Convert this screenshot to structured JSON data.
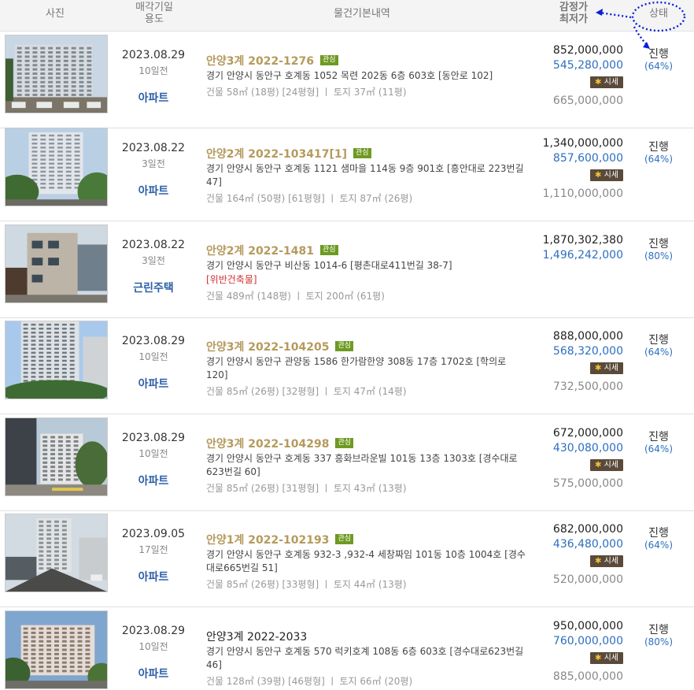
{
  "header": {
    "photo": "사진",
    "date_line1": "매각기일",
    "date_line2": "용도",
    "info": "물건기본내역",
    "price_line1": "감정가",
    "price_line2": "최저가",
    "status": "상태"
  },
  "badge_label": "관심",
  "market_label": "시세",
  "rows": [
    {
      "date": "2023.08.29",
      "ago": "10일전",
      "use": "아파트",
      "case": "안양3계 2022-1276",
      "badge": "관심",
      "addr": "경기 안양시 동안구 호계동 1052 목련 202동 6층 603호 [동안로 102]",
      "area": "건물 58㎡ (18평) [24평형]  ㅣ  토지 37㎡ (11평)",
      "appraised": "852,000,000",
      "min": "545,280,000",
      "market": "시세",
      "sale": "665,000,000",
      "status": "진행",
      "pct": "(64%)"
    },
    {
      "date": "2023.08.22",
      "ago": "3일전",
      "use": "아파트",
      "case": "안양2계 2022-103417[1]",
      "badge": "관심",
      "addr": "경기 안양시 동안구 호계동 1121 샘마을 114동 9층 901호 [흥안대로 223번길 47]",
      "area": "건물 164㎡ (50평) [61평형]  ㅣ  토지 87㎡ (26평)",
      "appraised": "1,340,000,000",
      "min": "857,600,000",
      "market": "시세",
      "sale": "1,110,000,000",
      "status": "진행",
      "pct": "(64%)"
    },
    {
      "date": "2023.08.22",
      "ago": "3일전",
      "use": "근린주택",
      "case": "안양2계 2022-1481",
      "badge": "관심",
      "addr": "경기 안양시 동안구 비산동 1014-6 [평촌대로411번길 38-7]",
      "warn": "[위반건축물]",
      "area": "건물 489㎡ (148평)  ㅣ  토지 200㎡ (61평)",
      "appraised": "1,870,302,380",
      "min": "1,496,242,000",
      "status": "진행",
      "pct": "(80%)"
    },
    {
      "date": "2023.08.29",
      "ago": "10일전",
      "use": "아파트",
      "case": "안양3계 2022-104205",
      "badge": "관심",
      "addr": "경기 안양시 동안구 관양동 1586 한가람한양 308동 17층 1702호 [학의로 120]",
      "area": "건물 85㎡ (26평) [32평형]  ㅣ  토지 47㎡ (14평)",
      "appraised": "888,000,000",
      "min": "568,320,000",
      "market": "시세",
      "sale": "732,500,000",
      "status": "진행",
      "pct": "(64%)"
    },
    {
      "date": "2023.08.29",
      "ago": "10일전",
      "use": "아파트",
      "case": "안양3계 2022-104298",
      "badge": "관심",
      "addr": "경기 안양시 동안구 호계동 337 흥화브라운빌 101동 13층 1303호 [경수대로623번길 60]",
      "area": "건물 85㎡ (26평) [31평형]  ㅣ  토지 43㎡ (13평)",
      "appraised": "672,000,000",
      "min": "430,080,000",
      "market": "시세",
      "sale": "575,000,000",
      "status": "진행",
      "pct": "(64%)"
    },
    {
      "date": "2023.09.05",
      "ago": "17일전",
      "use": "아파트",
      "case": "안양1계 2022-102193",
      "badge": "관심",
      "addr": "경기 안양시 동안구 호계동 932-3 ,932-4 세창짜임 101동 10층 1004호 [경수대로665번길 51]",
      "area": "건물 85㎡ (26평) [33평형]  ㅣ  토지 44㎡ (13평)",
      "appraised": "682,000,000",
      "min": "436,480,000",
      "market": "시세",
      "sale": "520,000,000",
      "status": "진행",
      "pct": "(64%)"
    },
    {
      "date": "2023.08.29",
      "ago": "10일전",
      "use": "아파트",
      "case": "안양3계 2022-2033",
      "case_dark": true,
      "addr": "경기 안양시 동안구 호계동 570 럭키호계 108동 6층 603호 [경수대로623번길 46]",
      "area": "건물 128㎡ (39평) [46평형]  ㅣ  토지 66㎡ (20평)",
      "appraised": "950,000,000",
      "min": "760,000,000",
      "market": "시세",
      "sale": "885,000,000",
      "status": "진행",
      "pct": "(80%)"
    }
  ]
}
